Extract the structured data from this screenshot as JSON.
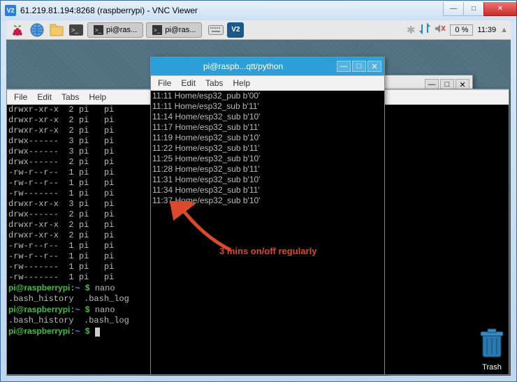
{
  "win7": {
    "icon_text": "V2",
    "title": "61.219.81.194:8268 (raspberrypi) - VNC Viewer",
    "min": "—",
    "max": "□",
    "close": "✕"
  },
  "panel": {
    "task1": "pi@ras...",
    "task2": "pi@ras...",
    "cpu": "0 %",
    "clock": "11:39"
  },
  "trash_label": "Trash",
  "term_back": {
    "min": "—",
    "max": "□",
    "close": "✕"
  },
  "term1": {
    "menu": {
      "file": "File",
      "edit": "Edit",
      "tabs": "Tabs",
      "help": "Help"
    },
    "lines": [
      "drwxr-xr-x  2 pi   pi",
      "drwxr-xr-x  2 pi   pi",
      "drwxr-xr-x  2 pi   pi",
      "drwx------  3 pi   pi",
      "drwx------  3 pi   pi",
      "drwx------  2 pi   pi",
      "-rw-r--r--  1 pi   pi",
      "-rw-r--r--  1 pi   pi",
      "-rw-------  1 pi   pi",
      "drwxr-xr-x  3 pi   pi",
      "drwx------  2 pi   pi",
      "drwxr-xr-x  2 pi   pi",
      "drwxr-xr-x  2 pi   pi",
      "-rw-r--r--  1 pi   pi",
      "-rw-r--r--  1 pi   pi",
      "-rw-------  1 pi   pi",
      "-rw-------  1 pi   pi"
    ],
    "prompt_user": "pi@raspberrypi",
    "prompt_path": "~",
    "prompt_dollar": "$",
    "cmd_nano": "nano",
    "hist_line": ".bash_history  .bash_log"
  },
  "term2": {
    "title": "pi@raspb...qtt/python",
    "min": "—",
    "max": "□",
    "close": "✕",
    "menu": {
      "file": "File",
      "edit": "Edit",
      "tabs": "Tabs",
      "help": "Help"
    },
    "lines": [
      "11:11 Home/esp32_pub b'00'",
      "11:11 Home/esp32_sub b'11'",
      "11:14 Home/esp32_sub b'10'",
      "11:17 Home/esp32_sub b'11'",
      "11:19 Home/esp32_sub b'10'",
      "11:22 Home/esp32_sub b'11'",
      "11:25 Home/esp32_sub b'10'",
      "11:28 Home/esp32_sub b'11'",
      "11:31 Home/esp32_sub b'10'",
      "11:34 Home/esp32_sub b'11'",
      "11:37 Home/esp32_sub b'10'"
    ]
  },
  "annotation": {
    "text": "3 mins on/off regularly"
  }
}
